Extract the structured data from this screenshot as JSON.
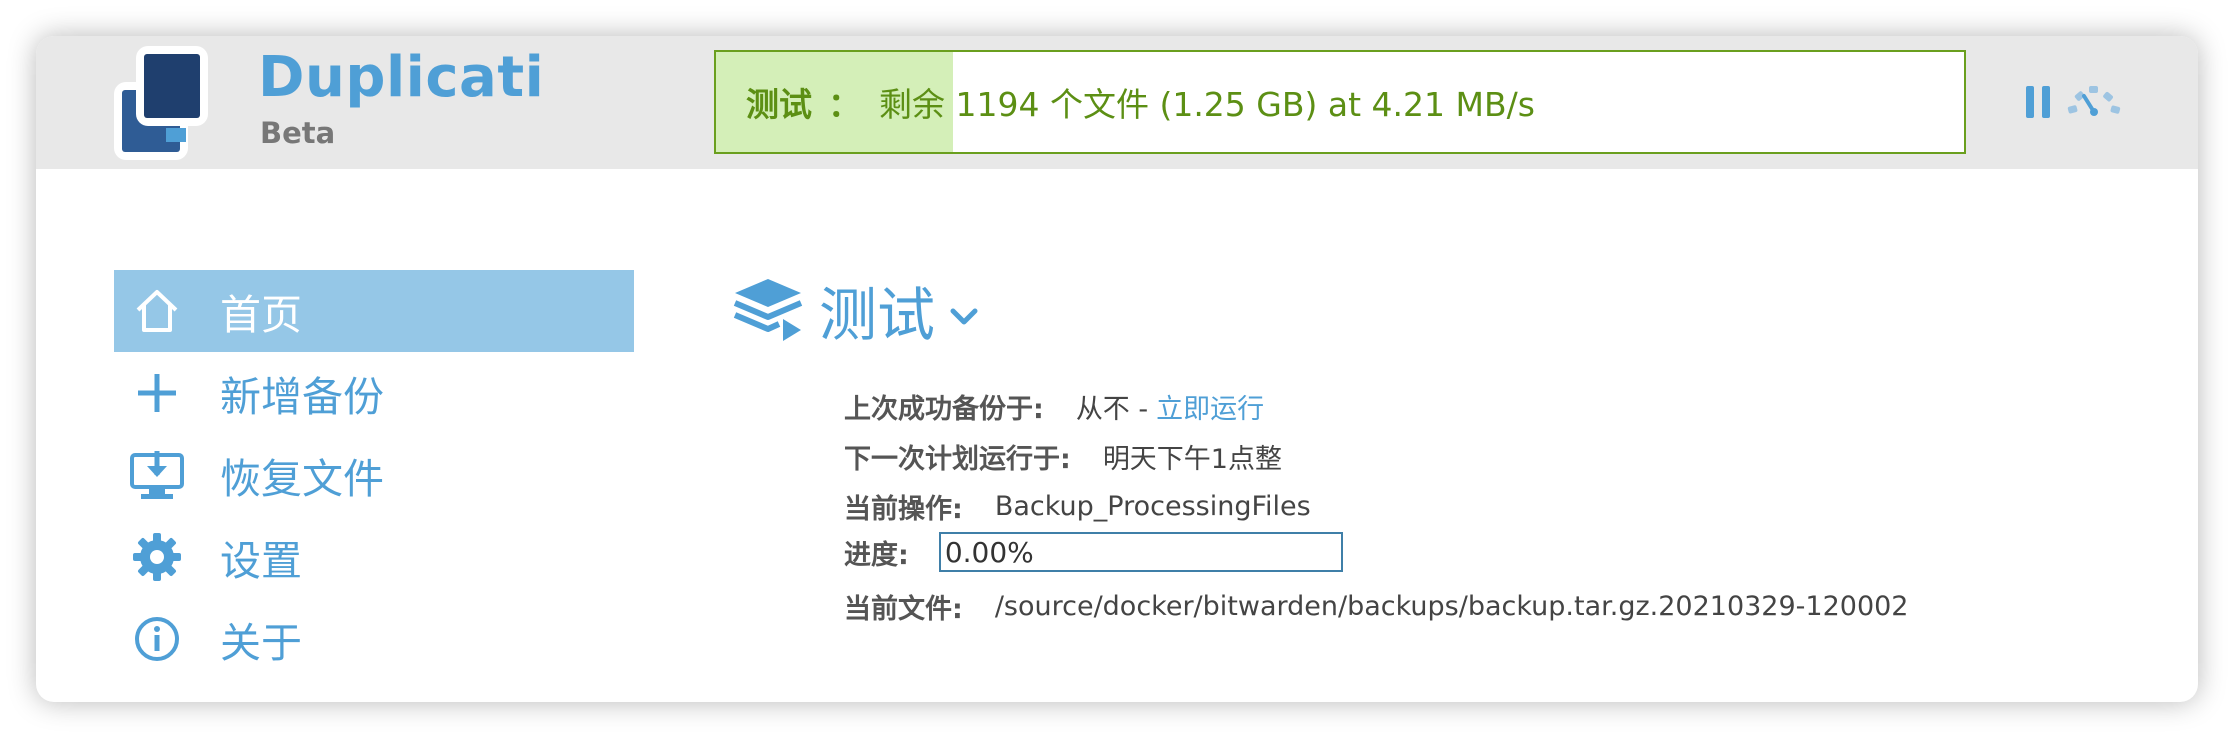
{
  "app": {
    "title": "Duplicati",
    "subtitle": "Beta"
  },
  "status_bar": {
    "job_name": "测试",
    "separator": "：",
    "status_text": "剩余 1194 个文件 (1.25 GB) at 4.21 MB/s",
    "progress_fraction": 0.19,
    "cancel_icon": "cancel-circle-icon",
    "pause_icon": "pause-icon",
    "throttle_icon": "speed-gauge-icon"
  },
  "sidebar": {
    "items": [
      {
        "label": "首页",
        "icon": "home-icon",
        "active": true
      },
      {
        "label": "新增备份",
        "icon": "plus-icon",
        "active": false
      },
      {
        "label": "恢复文件",
        "icon": "restore-icon",
        "active": false
      },
      {
        "label": "设置",
        "icon": "gear-icon",
        "active": false
      },
      {
        "label": "关于",
        "icon": "info-icon",
        "active": false
      }
    ]
  },
  "backup": {
    "name": "测试",
    "icon": "backup-stack-icon",
    "last_success_label": "上次成功备份于:",
    "last_success_value": "从不 -",
    "run_now_link": "立即运行",
    "next_run_label": "下一次计划运行于:",
    "next_run_value": "明天下午1点整",
    "current_op_label": "当前操作:",
    "current_op_value": "Backup_ProcessingFiles",
    "progress_label": "进度:",
    "progress_value": "0.00%",
    "progress_fraction": 0.0,
    "current_file_label": "当前文件:",
    "current_file_value": "/source/docker/bitwarden/backups/backup.tar.gz.20210329-120002"
  },
  "colors": {
    "brand_blue": "#4f9fd6",
    "active_menu_bg": "#95c7e7",
    "progress_green": "#5c8f14",
    "progress_fill": "#d4efb8",
    "logo_dark": "#1f3f6e"
  }
}
